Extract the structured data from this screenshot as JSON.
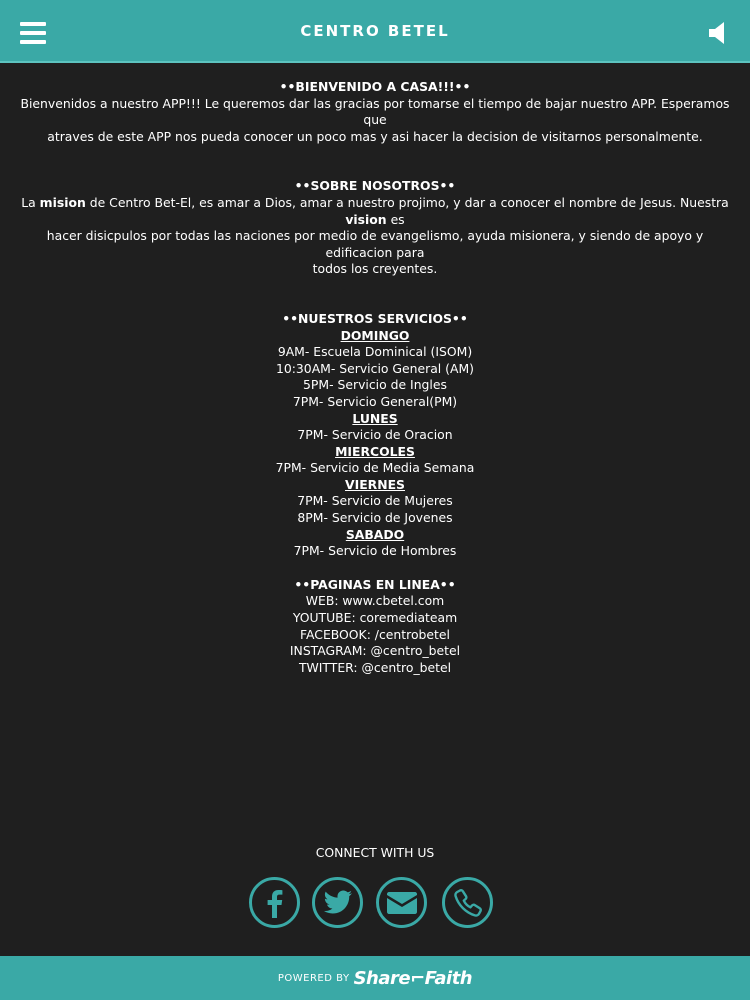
{
  "header": {
    "title": "CENTRO BETEL",
    "menu_icon": "hamburger-menu-icon",
    "sound_icon": "speaker-icon"
  },
  "welcome": {
    "heading": "••BIENVENIDO A CASA!!!••",
    "lines": [
      "Bienvenidos a nuestro APP!!! Le queremos dar las gracias por tomarse el tiempo de bajar nuestro APP. Esperamos que",
      "atraves de este APP nos pueda conocer un poco mas y asi hacer la decision de visitarnos personalmente."
    ]
  },
  "about": {
    "heading": "••SOBRE NOSOTROS••",
    "line1_prefix": "La ",
    "line1_bold1": "mision",
    "line1_mid": " de Centro Bet-El, es amar a Dios, amar a nuestro projimo, y dar a conocer el nombre de Jesus. Nuestra ",
    "line1_bold2": "vision",
    "line1_suffix": " es",
    "line2": "hacer disicpulos por todas las naciones por medio de evangelismo, ayuda misionera, y siendo de apoyo y edificacion para",
    "line3": "todos los creyentes."
  },
  "services": {
    "heading": "••NUESTROS SERVICIOS••",
    "days": [
      {
        "day": "DOMINGO",
        "items": [
          "9AM- Escuela Dominical (ISOM)",
          "10:30AM- Servicio General (AM)",
          "5PM- Servicio de Ingles",
          "7PM- Servicio General(PM)"
        ]
      },
      {
        "day": "LUNES",
        "items": [
          "7PM- Servicio de Oracion"
        ]
      },
      {
        "day": "MIERCOLES",
        "items": [
          "7PM- Servicio de Media Semana"
        ]
      },
      {
        "day": "VIERNES",
        "items": [
          "7PM- Servicio de Mujeres",
          "8PM- Servicio de Jovenes"
        ]
      },
      {
        "day": "SABADO",
        "items": [
          "7PM- Servicio de Hombres"
        ]
      }
    ]
  },
  "online": {
    "heading": "••PAGINAS EN LINEA••",
    "links": [
      "WEB: www.cbetel.com",
      "YOUTUBE: coremediateam",
      "FACEBOOK: /centrobetel",
      "INSTAGRAM: @centro_betel",
      "TWITTER: @centro_betel"
    ]
  },
  "connect": {
    "label": "CONNECT WITH US",
    "buttons": [
      "facebook-icon",
      "twitter-icon",
      "email-icon",
      "phone-icon"
    ]
  },
  "footer": {
    "powered_by": "POWERED BY",
    "brand": "Share⌐Faith"
  },
  "colors": {
    "accent": "#3aa9a6",
    "background": "#1f1f1f",
    "text": "#ffffff"
  }
}
